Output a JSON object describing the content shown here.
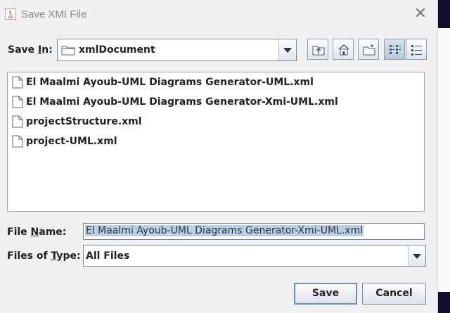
{
  "window": {
    "title": "Save XMI File"
  },
  "save_in": {
    "label_pre": "Save ",
    "label_mnemonic": "I",
    "label_post": "n:",
    "folder": "xmlDocument"
  },
  "toolbar": {
    "icons": [
      "up-one-level-icon",
      "home-icon",
      "create-new-folder-icon",
      "list-view-icon",
      "details-view-icon"
    ],
    "selected": "list-view-icon"
  },
  "files": [
    "El Maalmi Ayoub-UML Diagrams Generator-UML.xml",
    "El Maalmi Ayoub-UML Diagrams Generator-Xmi-UML.xml",
    "projectStructure.xml",
    "project-UML.xml"
  ],
  "file_name": {
    "label_pre": "File ",
    "label_mnemonic": "N",
    "label_post": "ame:",
    "value": "El Maalmi Ayoub-UML Diagrams Generator-Xmi-UML.xml"
  },
  "file_type": {
    "label_pre": "Files of ",
    "label_mnemonic": "T",
    "label_post": "ype:",
    "value": "All Files"
  },
  "buttons": {
    "save": "Save",
    "cancel": "Cancel"
  },
  "colors": {
    "selection": "#b8cfe5",
    "toolbar_selected": "#c6d6e6",
    "dialog_bg": "#f0f0f0"
  }
}
